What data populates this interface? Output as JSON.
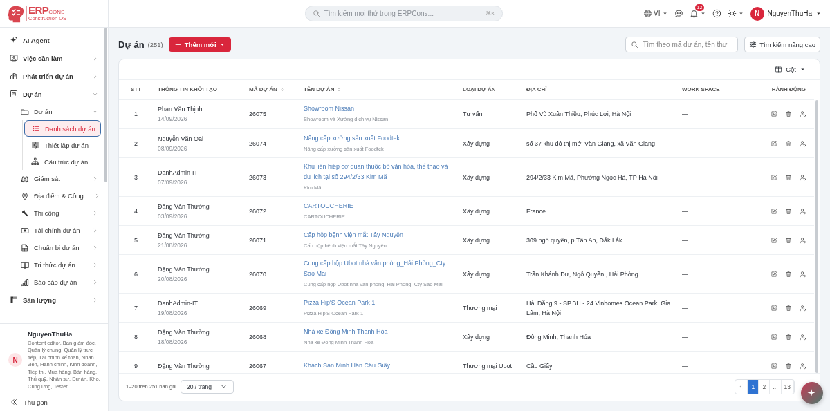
{
  "header": {
    "logo": {
      "brand": "ERP",
      "suffix": "CONS",
      "tagline": "Construction OS"
    },
    "search": {
      "placeholder": "Tìm kiếm mọi thứ trong ERPCons...",
      "shortcut": "⌘K"
    },
    "language": "VI",
    "notification_count": "12",
    "user": {
      "initial": "N",
      "name": "NguyenThuHa"
    }
  },
  "sidebar": {
    "items": [
      {
        "label": "AI Agent",
        "selected": false
      },
      {
        "label": "Việc cần làm",
        "selected": false,
        "expanded": false
      },
      {
        "label": "Phát triển dự án",
        "selected": false,
        "expanded": false
      },
      {
        "label": "Dự án",
        "selected": false,
        "expanded": true,
        "children": [
          {
            "label": "Dự án",
            "selected": false,
            "expanded": true,
            "children": [
              {
                "label": "Danh sách dự án",
                "selected": true
              },
              {
                "label": "Thiết lập dự án",
                "selected": false
              },
              {
                "label": "Cấu trúc dự án",
                "selected": false
              }
            ]
          },
          {
            "label": "Giám sát",
            "selected": false,
            "expanded": false
          },
          {
            "label": "Địa điểm & Công...",
            "selected": false,
            "expanded": false
          },
          {
            "label": "Thi công",
            "selected": false,
            "expanded": false
          },
          {
            "label": "Tài chính dự án",
            "selected": false,
            "expanded": false
          },
          {
            "label": "Chuẩn bị dự án",
            "selected": false,
            "expanded": false
          },
          {
            "label": "Tri thức dự án",
            "selected": false,
            "expanded": false
          },
          {
            "label": "Báo cáo dự án",
            "selected": false,
            "expanded": false
          }
        ]
      },
      {
        "label": "Sản lượng",
        "selected": false,
        "expanded": false
      }
    ],
    "user": {
      "initial": "N",
      "name": "NguyenThuHa",
      "roles": "Content editor, Ban giám đốc, Quản lý chung, Quản lý trực tiếp, Tài chính kế toán, Nhân viên, Hành chính, Kinh doanh, Tiếp thị, Mua hàng, Bán hàng, Thủ quỹ, Nhân sự, Dự án, Kho, Cung ứng, Tester"
    },
    "collapse_label": "Thu gọn"
  },
  "page": {
    "title": "Dự án",
    "count": "(251)",
    "add_button": "Thêm mới",
    "search_placeholder": "Tìm theo mã dự án, tên thư",
    "advanced_search": "Tìm kiếm nâng cao",
    "columns_button": "Cột"
  },
  "table": {
    "columns": [
      {
        "label": "STT",
        "sortable": false
      },
      {
        "label": "THÔNG TIN KHỞI TẠO",
        "sortable": false
      },
      {
        "label": "MÃ DỰ ÁN",
        "sortable": true
      },
      {
        "label": "TÊN DỰ ÁN",
        "sortable": true
      },
      {
        "label": "LOẠI DỰ ÁN",
        "sortable": false
      },
      {
        "label": "ĐỊA CHỈ",
        "sortable": false
      },
      {
        "label": "WORK SPACE",
        "sortable": false
      },
      {
        "label": "HÀNH ĐỘNG",
        "sortable": false
      }
    ],
    "rows": [
      {
        "stt": "1",
        "creator": "Phan Văn Thịnh",
        "date": "14/09/2026",
        "code": "26075",
        "name": "Showroom Nissan",
        "subtitle": "Showroom và Xưởng dịch vụ Nissan",
        "type": "Tư vấn",
        "address": "Phố Vũ Xuân Thiều, Phúc Lợi, Hà Nội",
        "workspace": "—"
      },
      {
        "stt": "2",
        "creator": "Nguyễn Văn Oai",
        "date": "08/09/2026",
        "code": "26074",
        "name": "Nâng cấp xưởng sản xuất Foodtek",
        "subtitle": "Nâng cấp xưởng sản xuất Foodtek",
        "type": "Xây dựng",
        "address": "số 37 khu đô thị mới Văn Giang, xã Văn Giang",
        "workspace": "—"
      },
      {
        "stt": "3",
        "creator": "DanhAdmin-IT",
        "date": "07/09/2026",
        "code": "26073",
        "name": "Khu liên hiệp cơ quan thuộc bộ văn hóa, thể thao và du lịch tại số 294/2/33 Kim Mã",
        "subtitle": "Kim Mã",
        "type": "Xây dựng",
        "address": "294/2/33 Kim Mã, Phường Ngọc Hà, TP Hà Nội",
        "workspace": "—"
      },
      {
        "stt": "4",
        "creator": "Đặng Văn Thường",
        "date": "03/09/2026",
        "code": "26072",
        "name": "CARTOUCHERIE",
        "subtitle": "CARTOUCHERIE",
        "type": "Xây dựng",
        "address": "France",
        "workspace": "—"
      },
      {
        "stt": "5",
        "creator": "Đặng Văn Thường",
        "date": "21/08/2026",
        "code": "26071",
        "name": "Cấp hộp bệnh viện mắt Tây Nguyên",
        "subtitle": "Cấp hộp bệnh viện mắt Tây Nguyên",
        "type": "Xây dựng",
        "address": "309 ngô quyền, p.Tân An, Đắk Lắk",
        "workspace": "—"
      },
      {
        "stt": "6",
        "creator": "Đặng Văn Thường",
        "date": "20/08/2026",
        "code": "26070",
        "name": "Cung cấp hộp Ubot nhà văn phòng_Hải Phòng_Cty Sao Mai",
        "subtitle": "Cung cấp hộp Ubot nhà văn phòng_Hải Phòng_Cty Sao Mai",
        "type": "Xây dựng",
        "address": "Trần Khánh Dư, Ngô Quyền , Hải Phòng",
        "workspace": "—"
      },
      {
        "stt": "7",
        "creator": "DanhAdmin-IT",
        "date": "19/08/2026",
        "code": "26069",
        "name": "Pizza Hip'S Ocean Park 1",
        "subtitle": "Pizza Hip'S Ocean Park 1",
        "type": "Thương mại",
        "address": "Hải Đăng 9 - SP.BH - 24 Vinhomes Ocean Park, Gia Lâm, Hà Nội",
        "workspace": "—"
      },
      {
        "stt": "8",
        "creator": "Đặng Văn Thường",
        "date": "18/08/2026",
        "code": "26068",
        "name": "Nhà xe Đông Minh Thanh Hóa",
        "subtitle": "Nhà xe Đông Minh Thanh Hóa",
        "type": "Xây dựng",
        "address": "Đông Minh, Thanh Hóa",
        "workspace": "—"
      },
      {
        "stt": "9",
        "creator": "Đặng Văn Thường",
        "code": "26067",
        "name": "Khách Sạn Minh Hân Cầu Giấy",
        "type": "Thương mại Ubot",
        "address": "Cầu Giấy",
        "workspace": "—"
      }
    ]
  },
  "footer": {
    "range": "1–20 trên 251 bản ghi",
    "page_size": "20 / trang",
    "pages": [
      {
        "label": "1",
        "selected": true
      },
      {
        "label": "2",
        "selected": false
      },
      {
        "label": "...",
        "selected": false
      },
      {
        "label": "13",
        "selected": false
      }
    ]
  }
}
